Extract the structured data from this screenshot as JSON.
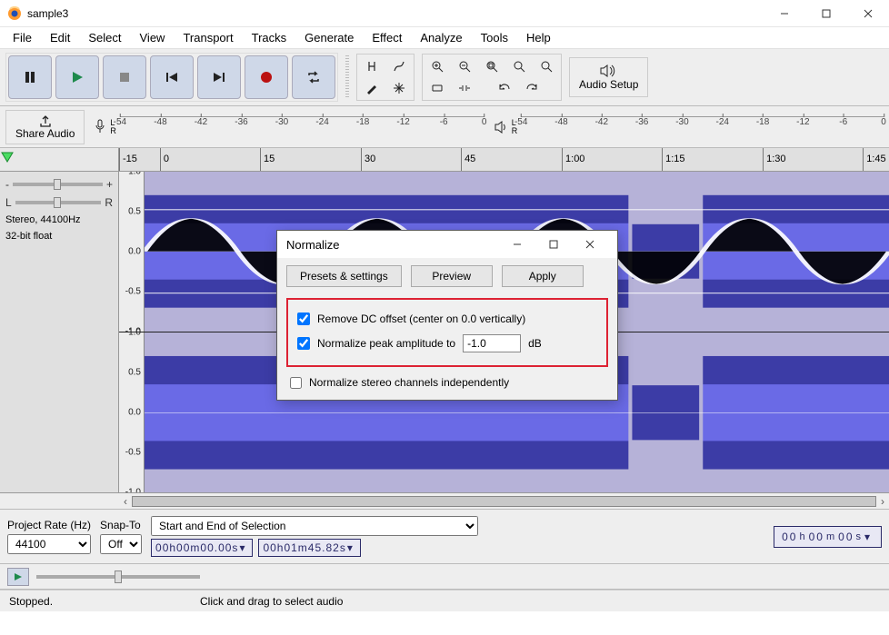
{
  "window": {
    "title": "sample3"
  },
  "menu": [
    "File",
    "Edit",
    "Select",
    "View",
    "Transport",
    "Tracks",
    "Generate",
    "Effect",
    "Analyze",
    "Tools",
    "Help"
  ],
  "toolbar": {
    "audio_setup": "Audio Setup",
    "share_audio": "Share Audio"
  },
  "meters": {
    "ticks": [
      "-54",
      "-48",
      "-42",
      "-36",
      "-30",
      "-24",
      "-18",
      "-12",
      "-6",
      "0"
    ],
    "lr": "L\nR"
  },
  "timeline": {
    "marks": [
      {
        "label": "-15",
        "pct": 0
      },
      {
        "label": "0",
        "pct": 5.3
      },
      {
        "label": "15",
        "pct": 18.3
      },
      {
        "label": "30",
        "pct": 31.4
      },
      {
        "label": "45",
        "pct": 44.4
      },
      {
        "label": "1:00",
        "pct": 57.5
      },
      {
        "label": "1:15",
        "pct": 70.5
      },
      {
        "label": "1:30",
        "pct": 83.6
      },
      {
        "label": "1:45",
        "pct": 96.6
      }
    ]
  },
  "track": {
    "gain": {
      "left": "-",
      "right": "+"
    },
    "pan": {
      "left": "L",
      "right": "R"
    },
    "info1": "Stereo, 44100Hz",
    "info2": "32-bit float",
    "axis": [
      "1.0",
      "0.5",
      "0.0",
      "-0.5",
      "-1.0"
    ]
  },
  "selection": {
    "project_rate_label": "Project Rate (Hz)",
    "project_rate_value": "44100",
    "snap_label": "Snap-To",
    "snap_value": "Off",
    "range_label": "Start and End of Selection",
    "start": "00h00m00.00s",
    "end": "00h01m45.82s",
    "big": "00h00m00s"
  },
  "status": {
    "state": "Stopped.",
    "hint": "Click and drag to select audio"
  },
  "dialog": {
    "title": "Normalize",
    "btn_presets": "Presets & settings",
    "btn_preview": "Preview",
    "btn_apply": "Apply",
    "cb_dc": "Remove DC offset (center on 0.0 vertically)",
    "cb_peak": "Normalize peak amplitude to",
    "peak_value": "-1.0",
    "db": "dB",
    "cb_indep": "Normalize stereo channels independently"
  }
}
